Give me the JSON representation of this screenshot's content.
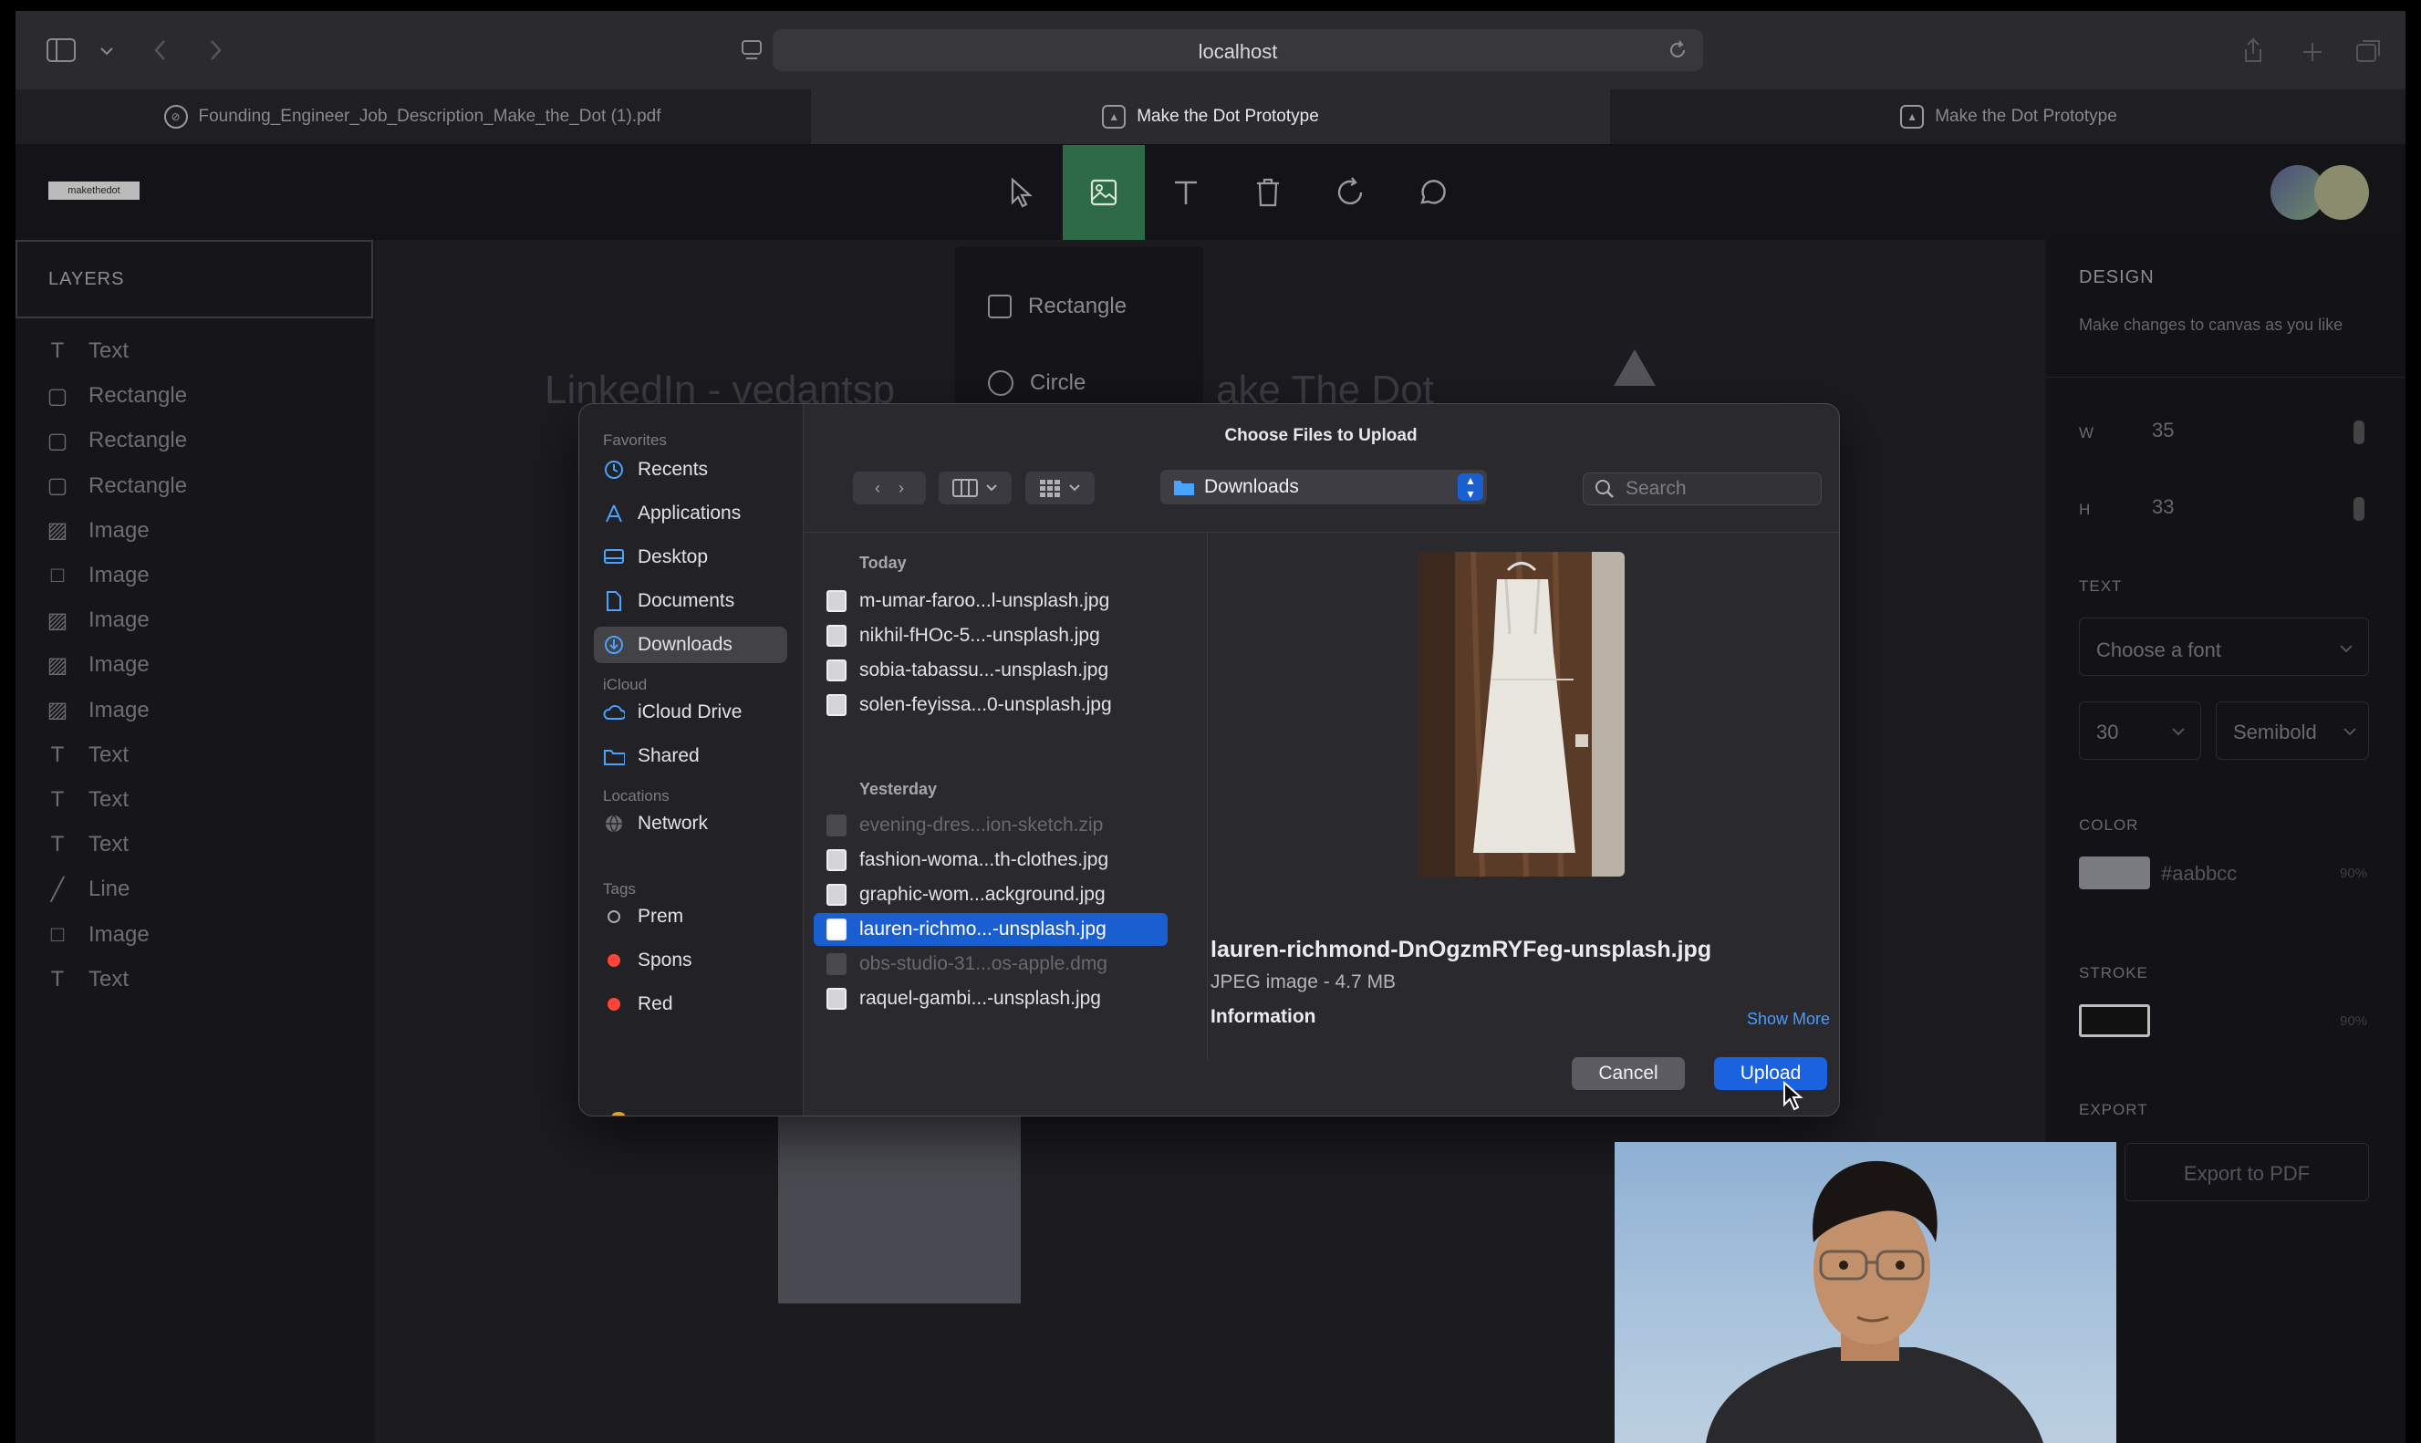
{
  "browser": {
    "url": "localhost",
    "tabs": [
      {
        "label": "Founding_Engineer_Job_Description_Make_the_Dot (1).pdf",
        "active": false
      },
      {
        "label": "Make the Dot Prototype",
        "active": true
      },
      {
        "label": "Make the Dot Prototype",
        "active": false
      }
    ]
  },
  "app": {
    "logo": "makethedot",
    "tools": [
      "select-icon",
      "image-icon",
      "text-icon",
      "trash-icon",
      "rotate-icon",
      "comment-icon"
    ],
    "active_tool": "image-icon"
  },
  "layers": {
    "title": "LAYERS",
    "items": [
      {
        "icon": "text-icon",
        "label": "Text"
      },
      {
        "icon": "rectangle-icon",
        "label": "Rectangle"
      },
      {
        "icon": "rectangle-icon",
        "label": "Rectangle"
      },
      {
        "icon": "rectangle-icon",
        "label": "Rectangle"
      },
      {
        "icon": "image-icon",
        "label": "Image"
      },
      {
        "icon": "square-icon",
        "label": "Image"
      },
      {
        "icon": "image-icon",
        "label": "Image"
      },
      {
        "icon": "image-icon",
        "label": "Image"
      },
      {
        "icon": "image-icon",
        "label": "Image"
      },
      {
        "icon": "text-icon",
        "label": "Text"
      },
      {
        "icon": "text-icon",
        "label": "Text"
      },
      {
        "icon": "text-icon",
        "label": "Text"
      },
      {
        "icon": "line-icon",
        "label": "Line"
      },
      {
        "icon": "square-icon",
        "label": "Image"
      },
      {
        "icon": "text-icon",
        "label": "Text"
      }
    ]
  },
  "canvas": {
    "text_left": "LinkedIn - vedantsp",
    "text_right": "ake The Dot",
    "shape_menu": [
      "Rectangle",
      "Circle"
    ]
  },
  "design": {
    "title": "DESIGN",
    "subtitle": "Make changes to canvas as you like",
    "w_label": "W",
    "w_value": "35",
    "h_label": "H",
    "h_value": "33",
    "text_label": "TEXT",
    "font_placeholder": "Choose a font",
    "font_size": "30",
    "font_weight": "Semibold",
    "color_label": "COLOR",
    "color_value": "#aabbcc",
    "color_opacity": "90%",
    "color_swatch": "#aabbcc",
    "stroke_label": "STROKE",
    "stroke_opacity": "90%",
    "export_label": "EXPORT",
    "export_button": "Export to PDF"
  },
  "dialog": {
    "title": "Choose Files to Upload",
    "sidebar": {
      "favorites_header": "Favorites",
      "favorites": [
        {
          "label": "Recents",
          "icon": "clock-icon"
        },
        {
          "label": "Applications",
          "icon": "applications-icon"
        },
        {
          "label": "Desktop",
          "icon": "desktop-icon"
        },
        {
          "label": "Documents",
          "icon": "document-icon"
        },
        {
          "label": "Downloads",
          "icon": "download-icon",
          "selected": true
        }
      ],
      "icloud_header": "iCloud",
      "icloud": [
        {
          "label": "iCloud Drive",
          "icon": "cloud-icon"
        },
        {
          "label": "Shared",
          "icon": "shared-folder-icon"
        }
      ],
      "locations_header": "Locations",
      "locations": [
        {
          "label": "Network",
          "icon": "globe-icon"
        }
      ],
      "tags_header": "Tags",
      "tags": [
        {
          "label": "Prem",
          "color": "none"
        },
        {
          "label": "Spons",
          "color": "#ff453a"
        },
        {
          "label": "Red",
          "color": "#ff453a"
        }
      ]
    },
    "location": "Downloads",
    "search_placeholder": "Search",
    "files": {
      "today_header": "Today",
      "today": [
        "m-umar-faroo...l-unsplash.jpg",
        "nikhil-fHOc-5...-unsplash.jpg",
        "sobia-tabassu...-unsplash.jpg",
        "solen-feyissa...0-unsplash.jpg"
      ],
      "yesterday_header": "Yesterday",
      "yesterday": [
        {
          "name": "evening-dres...ion-sketch.zip",
          "dim": true
        },
        {
          "name": "fashion-woma...th-clothes.jpg",
          "dim": false
        },
        {
          "name": "graphic-wom...ackground.jpg",
          "dim": false
        },
        {
          "name": "lauren-richmo...-unsplash.jpg",
          "dim": false,
          "selected": true
        },
        {
          "name": "obs-studio-31...os-apple.dmg",
          "dim": true
        },
        {
          "name": "raquel-gambi...-unsplash.jpg",
          "dim": false
        }
      ]
    },
    "preview": {
      "filename": "lauren-richmond-DnOgzmRYFeg-unsplash.jpg",
      "meta": "JPEG image - 4.7 MB",
      "info_label": "Information",
      "show_more": "Show More"
    },
    "cancel": "Cancel",
    "upload": "Upload"
  }
}
